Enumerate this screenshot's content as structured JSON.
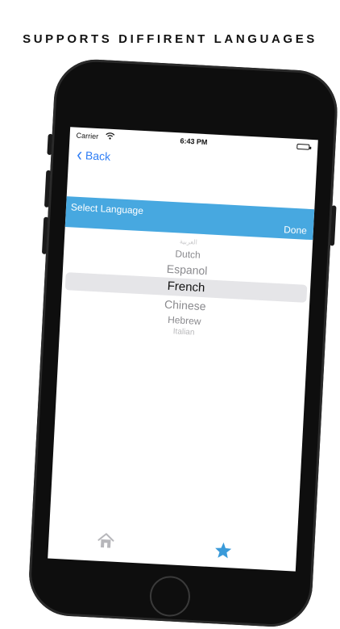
{
  "headline": "SUPPORTS DIFFIRENT LANGUAGES",
  "status_bar": {
    "carrier": "Carrier",
    "time": "6:43 PM"
  },
  "nav": {
    "back_label": "Back"
  },
  "toolbar": {
    "title": "Select Language",
    "done_label": "Done"
  },
  "picker": {
    "items": [
      "العربية",
      "Dutch",
      "Espanol",
      "French",
      "Chinese",
      "Hebrew",
      "Italian"
    ],
    "selected": "French"
  },
  "tab_bar": {
    "items": [
      "home-icon",
      "star-icon"
    ]
  },
  "colors": {
    "accent": "#47a8e0",
    "link": "#2f7ef5",
    "tab_active": "#3a9ad9",
    "tab_inactive": "#b7b7bb",
    "frame": "#0e0e0e"
  }
}
